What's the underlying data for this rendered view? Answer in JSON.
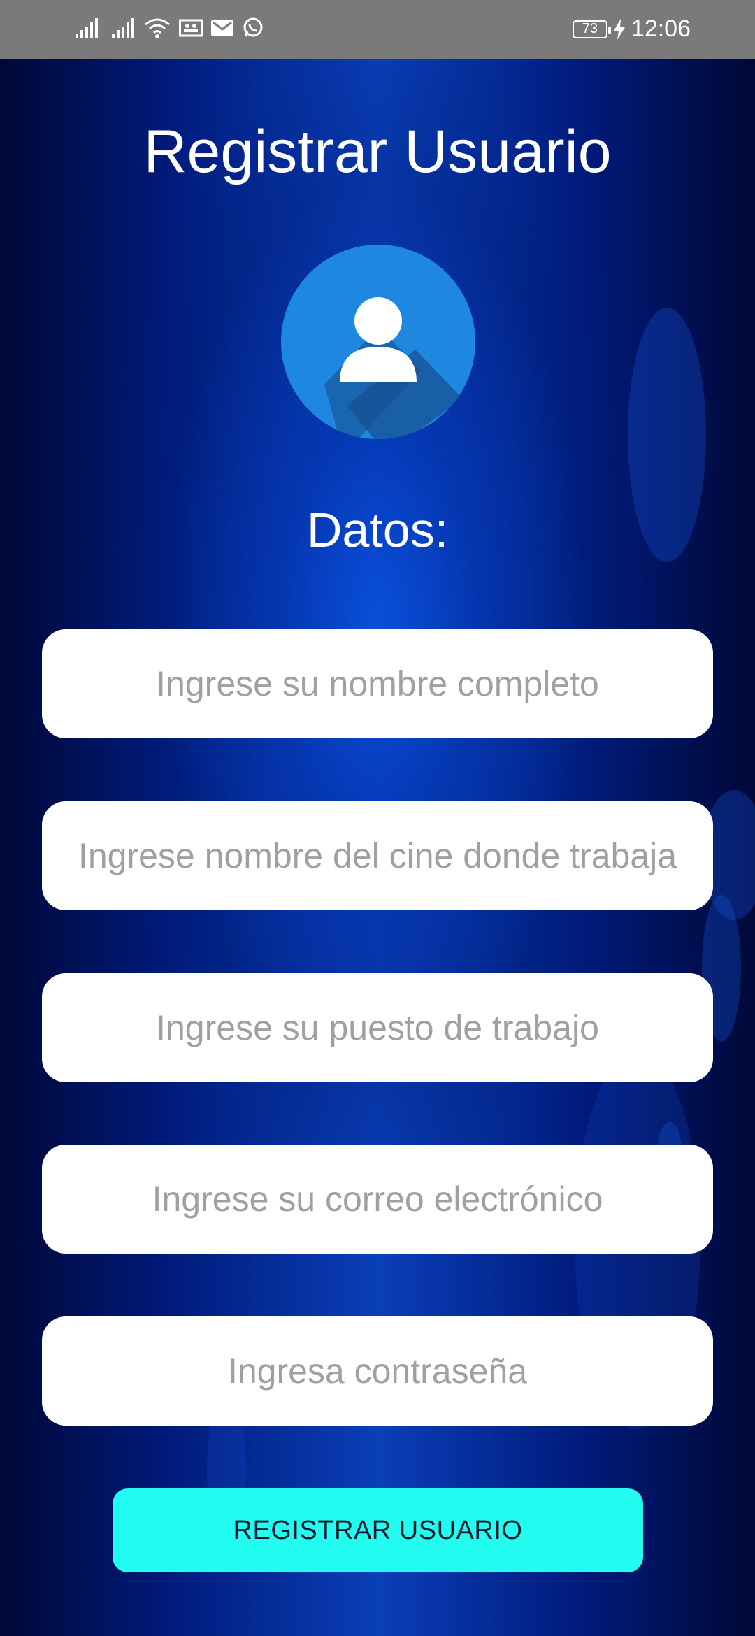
{
  "status_bar": {
    "time": "12:06",
    "battery": "73",
    "icons": [
      "signal-icon",
      "signal-icon",
      "wifi-icon",
      "contacts-card-icon",
      "mail-icon",
      "whatsapp-icon",
      "charging-icon"
    ]
  },
  "screen": {
    "title": "Registrar Usuario",
    "section_title": "Datos:",
    "avatar_icon": "user-avatar-icon"
  },
  "form": {
    "fields": [
      {
        "name": "nombre-completo",
        "value": "",
        "placeholder": "Ingrese su nombre completo"
      },
      {
        "name": "cine",
        "value": "",
        "placeholder": "Ingrese nombre del cine donde trabaja"
      },
      {
        "name": "puesto",
        "value": "",
        "placeholder": "Ingrese su puesto de trabajo"
      },
      {
        "name": "correo",
        "value": "",
        "placeholder": "Ingrese su correo electrónico"
      },
      {
        "name": "contrasena",
        "value": "",
        "placeholder": "Ingresa contraseña"
      }
    ],
    "submit_label": "REGISTRAR USUARIO"
  },
  "colors": {
    "status_bar": "#7a7a7a",
    "avatar": "#1e88e0",
    "button": "#21fbf0",
    "background_dark": "#000a3f",
    "background_glow": "#0a3fb8"
  }
}
